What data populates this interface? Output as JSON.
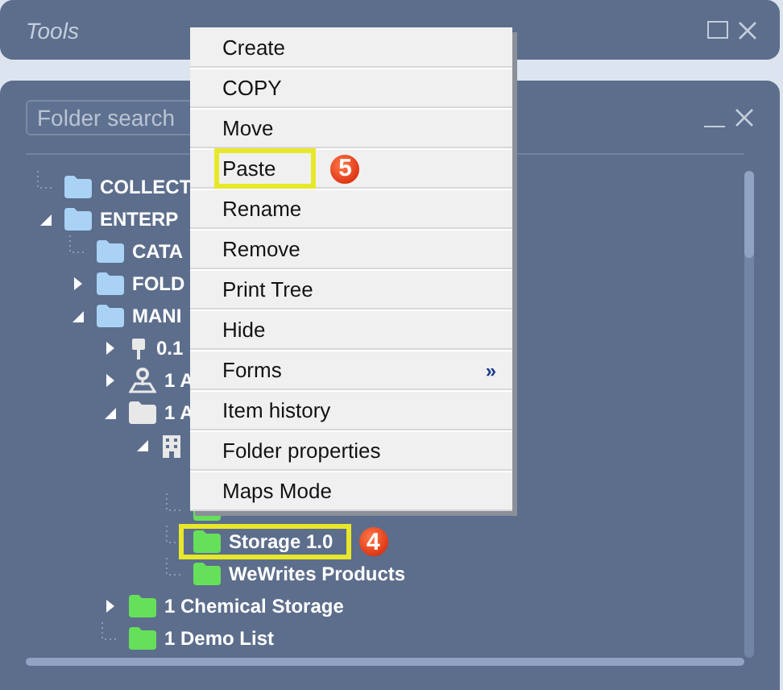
{
  "tools_window": {
    "title": "Tools"
  },
  "folder_window": {
    "search": {
      "placeholder": "Folder search"
    },
    "tree": [
      {
        "label": "COLLECT",
        "kind": "folder",
        "color": "#a9d2f5",
        "highlighted": false
      },
      {
        "label": "ENTERP",
        "kind": "folder",
        "color": "#a9d2f5",
        "expanded": true,
        "highlighted": false,
        "children": [
          {
            "label": "CATA",
            "kind": "folder",
            "color": "#a9d2f5",
            "highlighted": false
          },
          {
            "label": "FOLD",
            "kind": "folder",
            "color": "#a9d2f5",
            "expanded": false,
            "highlighted": false
          },
          {
            "label": "MANI",
            "kind": "folder",
            "color": "#a9d2f5",
            "expanded": true,
            "highlighted": false,
            "children": [
              {
                "label": "0.1",
                "kind": "pin",
                "expanded": false,
                "highlighted": false
              },
              {
                "label": "1 A",
                "kind": "map-person",
                "expanded": false,
                "highlighted": false
              },
              {
                "label": "1 A",
                "kind": "folder",
                "color": "#e8e8e8",
                "expanded": true,
                "highlighted": false,
                "children": [
                  {
                    "kind": "building",
                    "expanded": true,
                    "highlighted": false,
                    "children": [
                      {
                        "kind": "folder",
                        "color": "#66e05a",
                        "highlighted": false
                      },
                      {
                        "label": "Storage 1.0",
                        "kind": "folder",
                        "color": "#66e05a",
                        "highlighted": true,
                        "badge": "4"
                      },
                      {
                        "label": "WeWrites Products",
                        "kind": "folder",
                        "color": "#66e05a",
                        "highlighted": false
                      }
                    ]
                  }
                ]
              },
              {
                "label": "1 Chemical Storage",
                "kind": "folder",
                "color": "#66e05a",
                "expanded": false,
                "highlighted": false
              },
              {
                "label": "1 Demo List",
                "kind": "folder",
                "color": "#66e05a",
                "highlighted": false
              }
            ]
          }
        ]
      }
    ]
  },
  "context_menu": {
    "items": [
      {
        "label": "Create",
        "highlighted": false
      },
      {
        "label": "COPY",
        "highlighted": false
      },
      {
        "label": "Move",
        "highlighted": false
      },
      {
        "label": "Paste",
        "highlighted": true,
        "badge": "5"
      },
      {
        "label": "Rename",
        "highlighted": false
      },
      {
        "label": "Remove",
        "highlighted": false
      },
      {
        "label": "Print Tree",
        "highlighted": false
      },
      {
        "label": "Hide",
        "highlighted": false
      },
      {
        "label": "Forms",
        "highlighted": false,
        "submenu": "»"
      },
      {
        "label": "Item history",
        "highlighted": false
      },
      {
        "label": "Folder properties",
        "highlighted": false
      },
      {
        "label": "Maps Mode",
        "highlighted": false
      }
    ]
  }
}
